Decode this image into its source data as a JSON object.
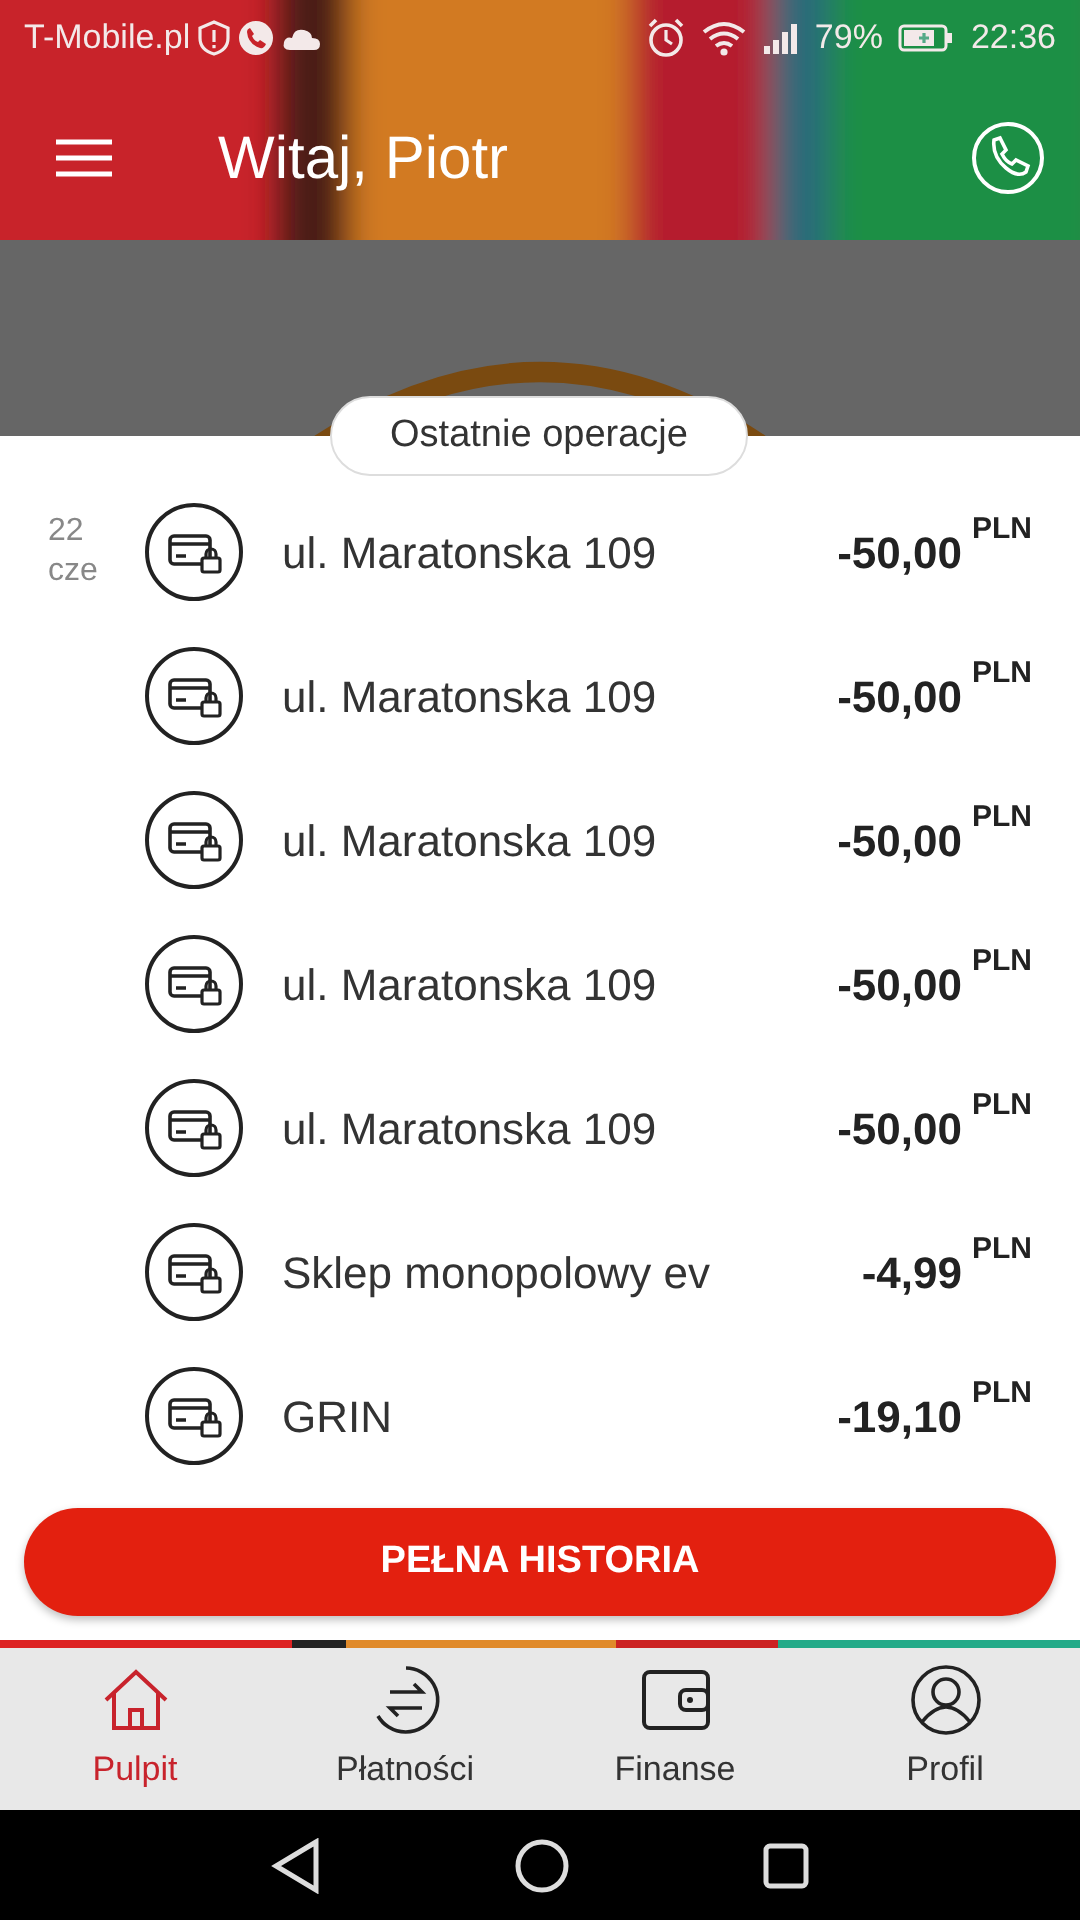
{
  "status_bar": {
    "carrier": "T-Mobile.pl",
    "battery": "79%",
    "time": "22:36"
  },
  "app_bar": {
    "title": "Witaj, Piotr"
  },
  "section_label": "Ostatnie operacje",
  "transactions": [
    {
      "day": "22",
      "month": "cze",
      "name": "ul. Maratonska 109",
      "amount": "-50,00",
      "currency": "PLN"
    },
    {
      "name": "ul. Maratonska 109",
      "amount": "-50,00",
      "currency": "PLN"
    },
    {
      "name": "ul. Maratonska 109",
      "amount": "-50,00",
      "currency": "PLN"
    },
    {
      "name": "ul. Maratonska 109",
      "amount": "-50,00",
      "currency": "PLN"
    },
    {
      "name": "ul. Maratonska 109",
      "amount": "-50,00",
      "currency": "PLN"
    },
    {
      "name": "Sklep monopolowy ev",
      "amount": "-4,99",
      "currency": "PLN"
    },
    {
      "name": "GRIN",
      "amount": "-19,10",
      "currency": "PLN"
    }
  ],
  "history_button": "PEŁNA HISTORIA",
  "bottom_nav": [
    {
      "kind": "home",
      "label": "Pulpit",
      "selected": true
    },
    {
      "kind": "transfer",
      "label": "Płatności",
      "selected": false
    },
    {
      "kind": "wallet",
      "label": "Finanse",
      "selected": false
    },
    {
      "kind": "profile",
      "label": "Profil",
      "selected": false
    }
  ]
}
